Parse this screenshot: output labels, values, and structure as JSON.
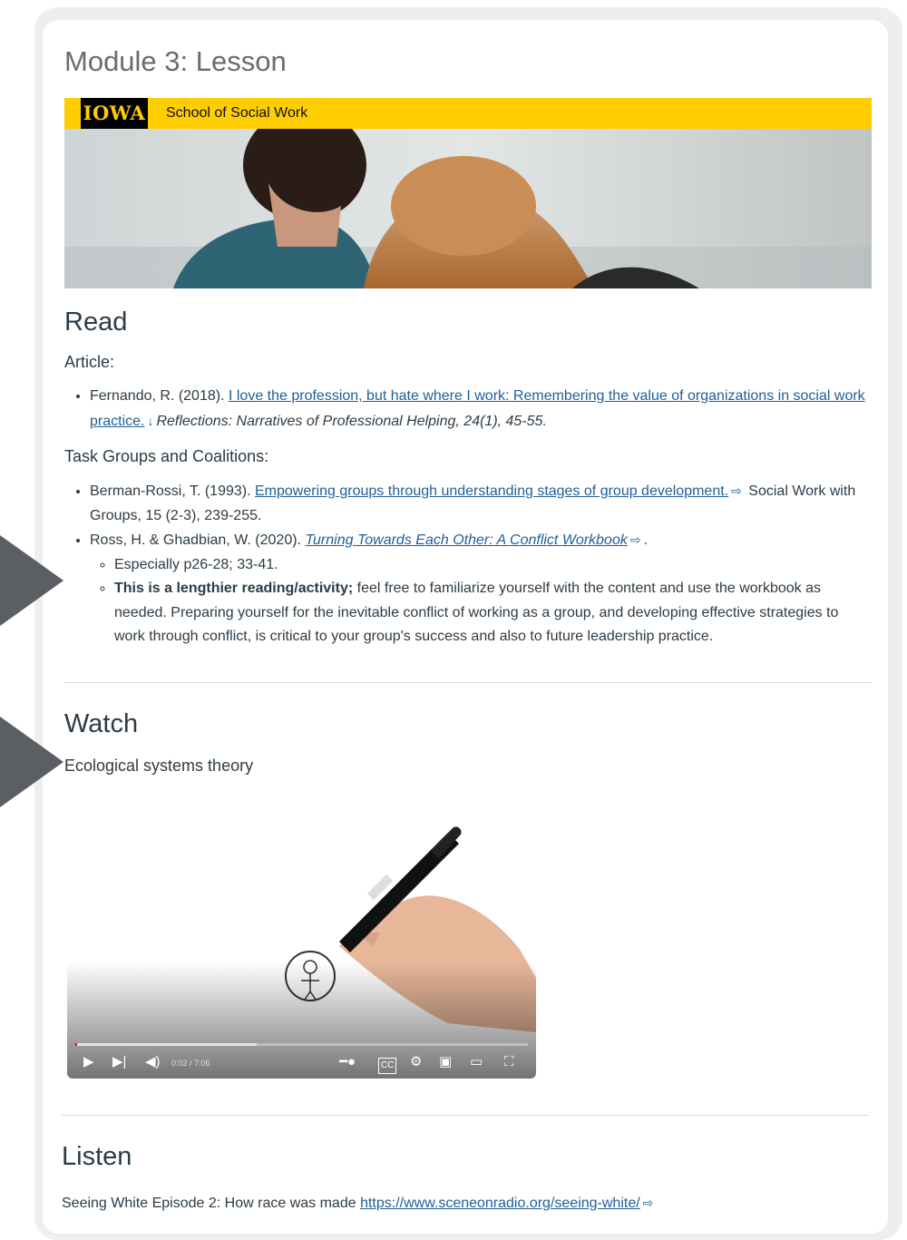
{
  "page": {
    "title": "Module 3: Lesson"
  },
  "banner": {
    "logo_text": "IOWA",
    "subtitle": "School of Social Work"
  },
  "read": {
    "heading": "Read",
    "article_label": "Article:",
    "article": {
      "pre": "Fernando, R. (2018). ",
      "link": "I love the profession, but hate where I work: Remembering the value of organizations in social work practice.",
      "post": "Reflections: Narratives of Professional Helping, 24(1), 45-55."
    },
    "task_label": "Task Groups and Coalitions:",
    "ref1": {
      "pre": "Berman-Rossi, T. (1993). ",
      "link": "Empowering groups through understanding stages of group development.",
      "post": " Social Work with Groups, 15 (2-3), 239-255."
    },
    "ref2": {
      "pre": "Ross, H. & Ghadbian, W. (2020). ",
      "link": "Turning Towards Each Other: A Conflict Workbook",
      "post": ".",
      "sub1": "Especially p26-28; 33-41.",
      "sub2_bold": "This is a lengthier reading/activity;",
      "sub2_rest": " feel free to familiarize yourself with the content and use the workbook as needed. Preparing yourself for the inevitable conflict of working as a group, and developing effective strategies to work through conflict, is critical to your group's success and also to future leadership practice."
    }
  },
  "watch": {
    "heading": "Watch",
    "video_title": "Ecological systems theory",
    "video": {
      "time": "0:02 / 7:06",
      "progress": 0.005,
      "buffered": 0.4
    }
  },
  "listen": {
    "heading": "Listen",
    "text": "Seeing White Episode 2: How race was made ",
    "link": "https://www.sceneonradio.org/seeing-white/"
  },
  "colors": {
    "accent": "#ffcd00",
    "link": "#1f5f9a",
    "arrow": "#5b5e63"
  }
}
